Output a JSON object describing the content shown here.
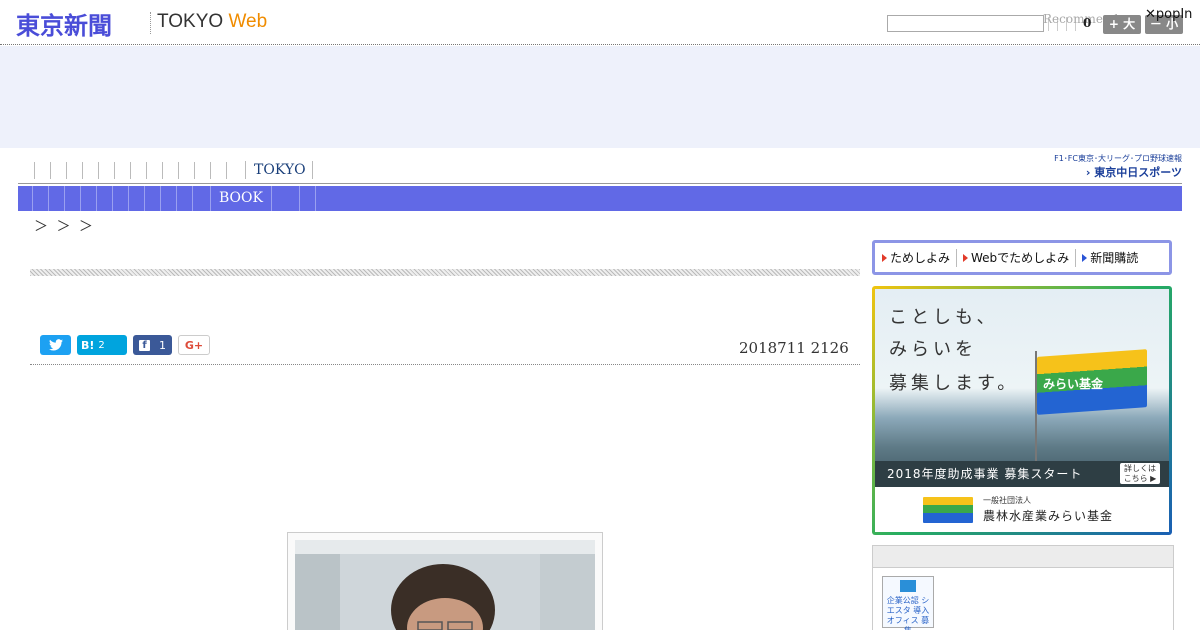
{
  "header": {
    "logo_jp": "東京新聞",
    "logo_en": "TOKYO",
    "logo_en_web": "Web",
    "search_value": "",
    "recommend": "Recommend",
    "count": "0",
    "size_large": "+ 大",
    "size_small": "－ 小",
    "popin": "✕popIn"
  },
  "nav1": {
    "tokyo": "TOKYO",
    "chunichi_line1": "F1･FC東京･大リーグ･プロ野球速報",
    "chunichi_line2": "› 東京中日スポーツ"
  },
  "nav2": {
    "book": "BOOK"
  },
  "breadcrumb": "＞ ＞ ＞",
  "article": {
    "date": "2018711 2126",
    "share": {
      "twitter_icon": "twitter-icon",
      "hatena_label": "B!",
      "hatena_count": "2",
      "facebook_label": "f",
      "facebook_count": "1",
      "gplus_label": "G+"
    }
  },
  "sidebar": {
    "tabs": [
      {
        "label": "ためしよみ"
      },
      {
        "label": "Webでためしよみ"
      },
      {
        "label": "新聞購読"
      }
    ],
    "ad": {
      "line1": "ことしも、",
      "line2": "みらいを",
      "line3": "募集します。",
      "flag_text": "みらい基金",
      "bar_text": "2018年度助成事業 募集スタート",
      "bar_button": "詳しくは こちら ▶",
      "foot_line1": "一般社団法人",
      "foot_line2": "農林水産業みらい基金"
    },
    "badge": "企業公認 シエスタ 導入オフィス 募集"
  },
  "colors": {
    "brand_blue": "#4a4dd8",
    "nav_bar": "#6169e6",
    "ad_band": "#eef1fb",
    "web_orange": "#f08c00"
  }
}
